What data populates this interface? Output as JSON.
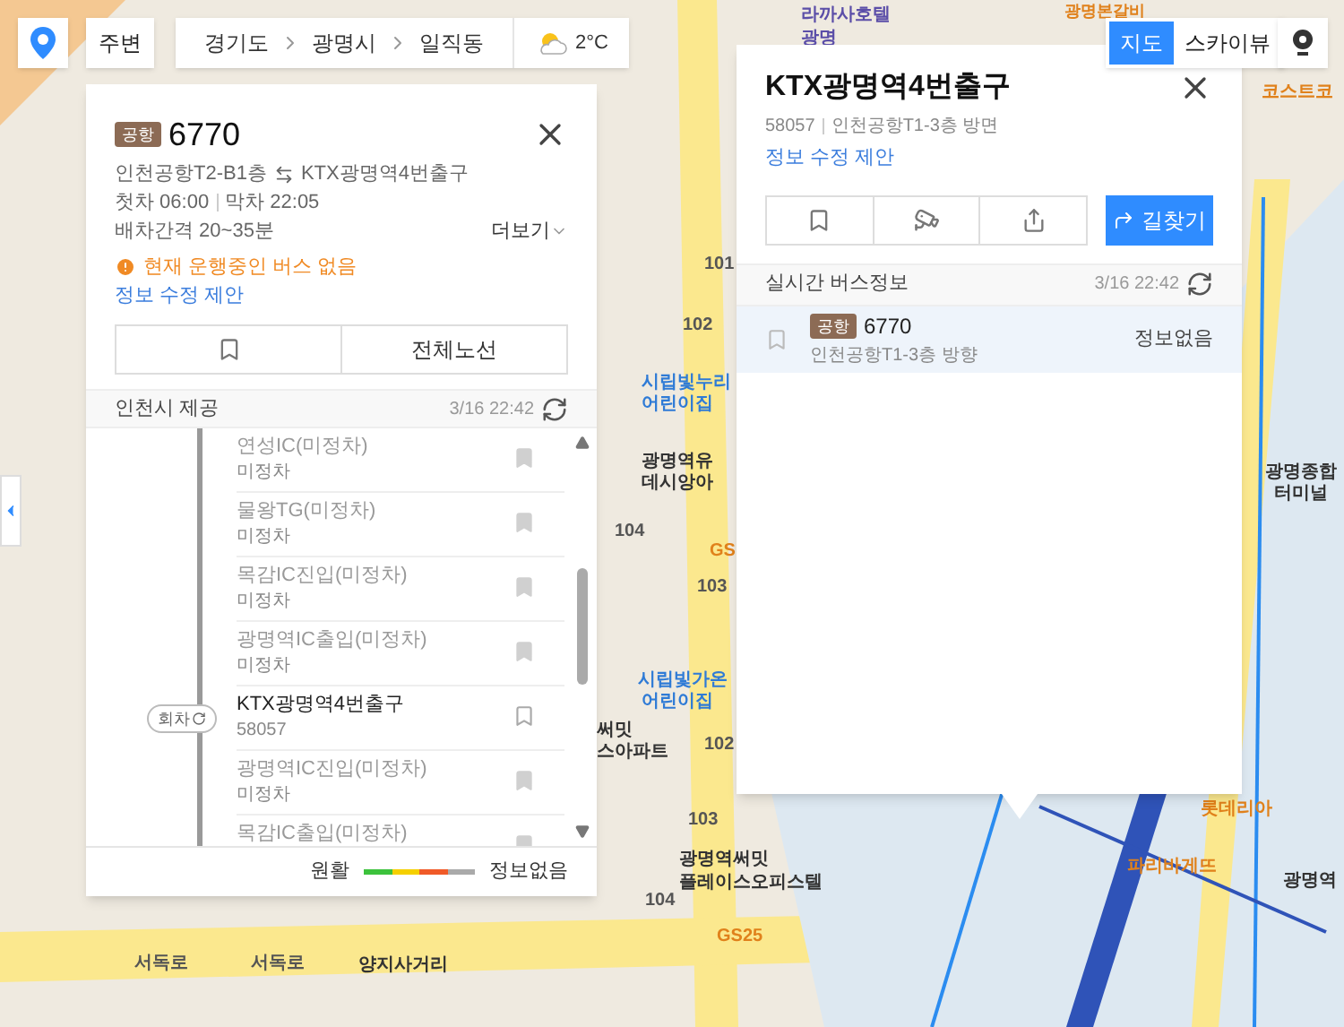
{
  "top_bar": {
    "breadcrumb": [
      "경기도",
      "광명시",
      "일직동"
    ],
    "weather": "2°C",
    "nearby_button": "주변"
  },
  "map_type": [
    {
      "label": "지도",
      "selected": true
    },
    {
      "label": "스카이뷰",
      "selected": false
    }
  ],
  "map_labels": [
    {
      "text": "라까사호텔",
      "kind": "hotel"
    },
    {
      "text": "광명",
      "kind": "hotel"
    },
    {
      "text": "광명본갈비",
      "kind": "shop"
    },
    {
      "text": "코스트코",
      "kind": "shop"
    },
    {
      "text": "101",
      "kind": "number"
    },
    {
      "text": "102",
      "kind": "number"
    },
    {
      "text": "시립빛누리",
      "kind": "school"
    },
    {
      "text": "어린이집",
      "kind": "school"
    },
    {
      "text": "광명역유",
      "kind": "building"
    },
    {
      "text": "데시앙아",
      "kind": "building"
    },
    {
      "text": "104",
      "kind": "number"
    },
    {
      "text": "GS",
      "kind": "shop"
    },
    {
      "text": "103",
      "kind": "number"
    },
    {
      "text": "시립빛가온",
      "kind": "school"
    },
    {
      "text": "어린이집",
      "kind": "school"
    },
    {
      "text": "써밋",
      "kind": "building"
    },
    {
      "text": "스아파트",
      "kind": "building"
    },
    {
      "text": "102",
      "kind": "number"
    },
    {
      "text": "103",
      "kind": "number"
    },
    {
      "text": "광명역써밋",
      "kind": "building"
    },
    {
      "text": "플레이스오피스텔",
      "kind": "building"
    },
    {
      "text": "104",
      "kind": "number"
    },
    {
      "text": "GS25",
      "kind": "shop"
    },
    {
      "text": "서독로",
      "kind": "road"
    },
    {
      "text": "서독로",
      "kind": "road"
    },
    {
      "text": "양지사거리",
      "kind": "building"
    },
    {
      "text": "광명종합",
      "kind": "building"
    },
    {
      "text": "터미널",
      "kind": "building"
    },
    {
      "text": "롯데리아",
      "kind": "shop"
    },
    {
      "text": "파리바게뜨",
      "kind": "shop"
    },
    {
      "text": "광명역",
      "kind": "building"
    }
  ],
  "route_panel": {
    "badge": "공항",
    "number": "6770",
    "from": "인천공항T2-B1층",
    "to": "KTX광명역4번출구",
    "first": "첫차 06:00",
    "last": "막차 22:05",
    "interval": "배차간격 20~35분",
    "more": "더보기",
    "warning": "현재 운행중인 버스 없음",
    "suggest": "정보 수정 제안",
    "full_route": "전체노선",
    "provider": "인천시 제공",
    "updated": "3/16 22:42",
    "stops": [
      {
        "name": "연성IC(미정차)",
        "sub": "미정차",
        "current": false
      },
      {
        "name": "물왕TG(미정차)",
        "sub": "미정차",
        "current": false
      },
      {
        "name": "목감IC진입(미정차)",
        "sub": "미정차",
        "current": false
      },
      {
        "name": "광명역IC출입(미정차)",
        "sub": "미정차",
        "current": false
      },
      {
        "name": "KTX광명역4번출구",
        "sub": "58057",
        "current": true,
        "turn": "회차"
      },
      {
        "name": "광명역IC진입(미정차)",
        "sub": "미정차",
        "current": false
      },
      {
        "name": "목감IC출입(미정차)",
        "current": false
      }
    ],
    "legend": {
      "smooth": "원활",
      "none": "정보없음"
    }
  },
  "stop_panel": {
    "title": "KTX광명역4번출구",
    "id": "58057",
    "direction": "인천공항T1-3층 방면",
    "suggest": "정보 수정 제안",
    "route_button": "길찾기",
    "section": "실시간 버스정보",
    "updated": "3/16 22:42",
    "buses": [
      {
        "badge": "공항",
        "number": "6770",
        "direction": "인천공항T1-3층 방향",
        "status": "정보없음"
      }
    ]
  }
}
